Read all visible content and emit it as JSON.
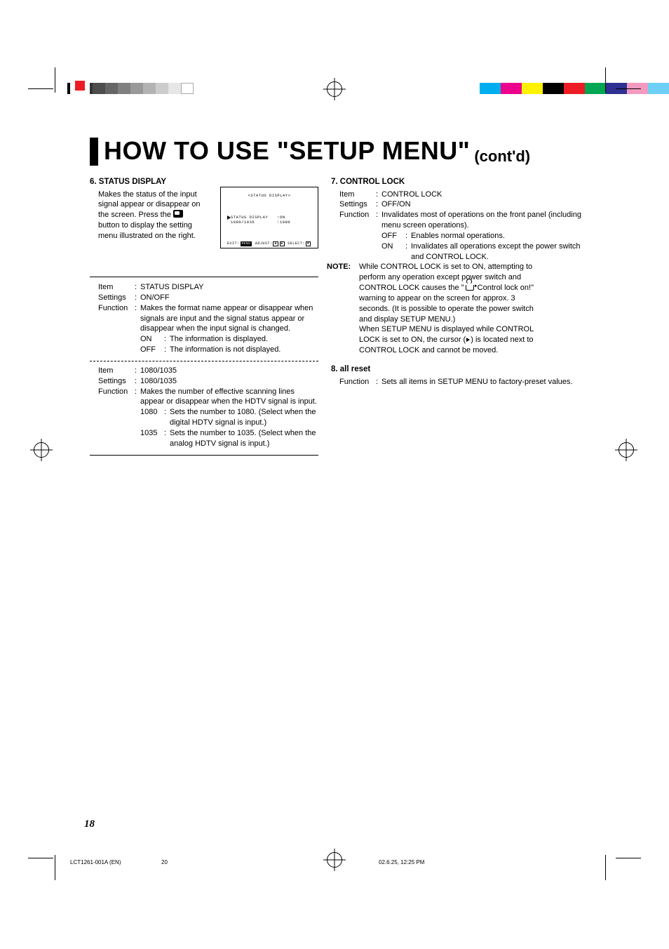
{
  "title": "HOW TO USE \"SETUP MENU\"",
  "title_cont": "(cont'd)",
  "section6": {
    "heading": "6. STATUS DISPLAY",
    "intro_l1": "Makes the status of the input",
    "intro_l2": "signal appear or disappear on",
    "intro_l3a": "the screen. Press the",
    "intro_l4": "button to display the setting",
    "intro_l5": "menu illustrated on the right.",
    "block1": {
      "item": "STATUS DISPLAY",
      "settings": "ON/OFF",
      "function": "Makes the format name appear or disappear when signals are input and the signal status appear or disappear when the input signal is changed.",
      "on": "The information is displayed.",
      "off": "The information is not displayed."
    },
    "block2": {
      "item": "1080/1035",
      "settings": "1080/1035",
      "function": "Makes the number of effective scanning lines appear or disappear when the HDTV signal is input.",
      "n1080": "Sets the number to 1080. (Select when the digital HDTV signal is input.)",
      "n1035": "Sets the number to 1035. (Select when the analog HDTV signal is input.)"
    }
  },
  "screen": {
    "title": "<STATUS DISPLAY>",
    "row1_label": "STATUS DISPLAY",
    "row1_value": "ON",
    "row2_label": "1080/1035",
    "row2_value": "1080",
    "footer_exit": "EXIT",
    "footer_menu": "MENU",
    "footer_adjust": "ADJUST",
    "footer_select": "SELECT"
  },
  "section7": {
    "heading": "7. CONTROL LOCK",
    "item": "CONTROL LOCK",
    "settings": "OFF/ON",
    "function": "Invalidates most of operations on the front panel (including menu screen operations).",
    "off": "Enables normal operations.",
    "on": "Invalidates all operations except the power switch and CONTROL LOCK.",
    "note_l1": "While CONTROL LOCK is set to ON, attempting to",
    "note_l2": "perform any operation except power switch and",
    "note_l3a": "CONTROL LOCK causes the \"",
    "note_l3b": " Control lock on!\"",
    "note_l4": "warning to appear on the screen for approx. 3",
    "note_l5": "seconds. (It is possible to operate the power switch",
    "note_l6": "and display SETUP MENU.)",
    "note_l7": "When SETUP MENU is displayed while CONTROL",
    "note_l8a": "LOCK is set to ON, the cursor (",
    "note_l8b": ") is located next to",
    "note_l9": "CONTROL LOCK and cannot be moved."
  },
  "section8": {
    "heading": "8. all reset",
    "function": "Sets all items in SETUP MENU to factory-preset values."
  },
  "labels": {
    "item": "Item",
    "settings": "Settings",
    "function": "Function",
    "on": "ON",
    "off": "OFF",
    "n1080": "1080",
    "n1035": "1035",
    "note": "NOTE:"
  },
  "page_number": "18",
  "footer": {
    "left": "LCT1261-001A (EN)",
    "mid": "20",
    "right": "02.6.25, 12:25 PM"
  }
}
